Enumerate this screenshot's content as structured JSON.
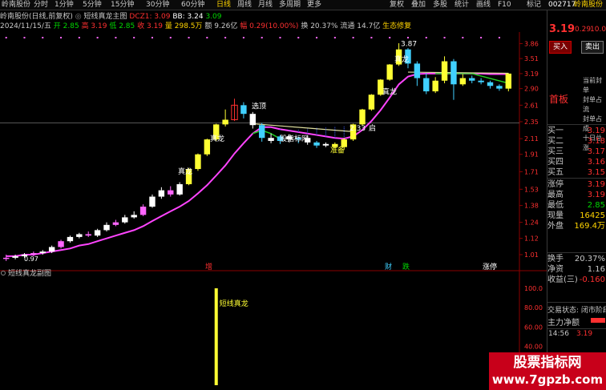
{
  "toolbar": {
    "stock_name": "岭南股份",
    "periods": [
      "分时",
      "1分钟",
      "5分钟",
      "15分钟",
      "30分钟",
      "60分钟",
      "日线",
      "周线",
      "月线",
      "多周期",
      "更多"
    ],
    "active_period": "日线",
    "tools": [
      "复权",
      "叠加",
      "多股",
      "统计",
      "画线",
      "F10",
      "标记"
    ],
    "right_code": "002717",
    "right_name": "岭南股份"
  },
  "info": {
    "line1_prefix": "岭南股份(日线,前复权)",
    "indicator_name": "短线真龙主图",
    "dcz": "DCZ1: 3.09",
    "bb": "BB: 3.24",
    "bb2": "3.09",
    "line2": {
      "date": "2024/11/15/五",
      "open": "开 2.85",
      "high": "高 3.19",
      "low": "低 2.85",
      "close": "收 3.19",
      "volume": "量 298.5万",
      "amount": "额 9.26亿",
      "change": "幅 0.29(10.00%)",
      "turnover": "换 20.37%",
      "float": "流通 14.7亿",
      "ecology": "生态修复"
    }
  },
  "chart_labels": {
    "xuanding": "选顶",
    "zhenlong": "真龙",
    "yidianchuanjiu": "股指标网",
    "zhunbei": "准备",
    "price_high": "3.87",
    "price_low": "0.97",
    "price_mid": "2.33",
    "qi_tag": "启",
    "zeng": "增",
    "cai": "财",
    "die": "跌",
    "zhangting": "涨停"
  },
  "sub_indicator": {
    "title": "短线真龙副图",
    "label": "短线真龙",
    "axis": [
      "100.0",
      "80.00",
      "60.00",
      "40.00",
      "20.00",
      "0.00"
    ]
  },
  "price_axis": [
    "3.86",
    "3.51",
    "3.19",
    "2.90",
    "2.61",
    "2.35",
    "2.11",
    "1.91",
    "1.71",
    "1.53",
    "1.38",
    "1.24",
    "1.12",
    "1.01"
  ],
  "chart_data": {
    "type": "candlestick",
    "candles": [
      {
        "o": 0.99,
        "c": 0.99,
        "h": 1.01,
        "l": 0.97
      },
      {
        "o": 0.99,
        "c": 1.0,
        "h": 1.01,
        "l": 0.98
      },
      {
        "o": 1.0,
        "c": 1.01,
        "h": 1.02,
        "l": 0.99
      },
      {
        "o": 1.01,
        "c": 1.02,
        "h": 1.03,
        "l": 1.0
      },
      {
        "o": 1.02,
        "c": 1.03,
        "h": 1.04,
        "l": 1.01
      },
      {
        "o": 1.03,
        "c": 1.06,
        "h": 1.07,
        "l": 1.02
      },
      {
        "o": 1.06,
        "c": 1.1,
        "h": 1.11,
        "l": 1.05
      },
      {
        "o": 1.1,
        "c": 1.13,
        "h": 1.14,
        "l": 1.09
      },
      {
        "o": 1.13,
        "c": 1.15,
        "h": 1.16,
        "l": 1.12
      },
      {
        "o": 1.15,
        "c": 1.14,
        "h": 1.17,
        "l": 1.13
      },
      {
        "o": 1.14,
        "c": 1.18,
        "h": 1.19,
        "l": 1.13
      },
      {
        "o": 1.18,
        "c": 1.22,
        "h": 1.24,
        "l": 1.17
      },
      {
        "o": 1.22,
        "c": 1.24,
        "h": 1.26,
        "l": 1.21
      },
      {
        "o": 1.24,
        "c": 1.28,
        "h": 1.3,
        "l": 1.23
      },
      {
        "o": 1.28,
        "c": 1.3,
        "h": 1.33,
        "l": 1.27
      },
      {
        "o": 1.3,
        "c": 1.37,
        "h": 1.39,
        "l": 1.29
      },
      {
        "o": 1.37,
        "c": 1.46,
        "h": 1.48,
        "l": 1.36
      },
      {
        "o": 1.46,
        "c": 1.52,
        "h": 1.55,
        "l": 1.44
      },
      {
        "o": 1.52,
        "c": 1.48,
        "h": 1.56,
        "l": 1.46
      },
      {
        "o": 1.48,
        "c": 1.58,
        "h": 1.6,
        "l": 1.47
      },
      {
        "o": 1.58,
        "c": 1.74,
        "h": 1.75,
        "l": 1.57
      },
      {
        "o": 1.74,
        "c": 1.91,
        "h": 1.92,
        "l": 1.72
      },
      {
        "o": 1.91,
        "c": 2.1,
        "h": 2.11,
        "l": 1.89
      },
      {
        "o": 2.1,
        "c": 2.31,
        "h": 2.32,
        "l": 2.08
      },
      {
        "o": 2.31,
        "c": 2.38,
        "h": 2.54,
        "l": 2.28
      },
      {
        "o": 2.38,
        "c": 2.61,
        "h": 2.72,
        "l": 2.36
      },
      {
        "o": 2.61,
        "c": 2.47,
        "h": 2.66,
        "l": 2.4
      },
      {
        "o": 2.47,
        "c": 2.3,
        "h": 2.5,
        "l": 2.25
      },
      {
        "o": 2.3,
        "c": 2.12,
        "h": 2.33,
        "l": 2.07
      },
      {
        "o": 2.12,
        "c": 2.08,
        "h": 2.18,
        "l": 2.05
      },
      {
        "o": 2.08,
        "c": 2.14,
        "h": 2.16,
        "l": 2.04
      },
      {
        "o": 2.14,
        "c": 2.1,
        "h": 2.17,
        "l": 2.06
      },
      {
        "o": 2.1,
        "c": 2.12,
        "h": 2.14,
        "l": 2.05
      },
      {
        "o": 2.12,
        "c": 2.06,
        "h": 2.15,
        "l": 2.03
      },
      {
        "o": 2.06,
        "c": 2.02,
        "h": 2.08,
        "l": 1.99
      },
      {
        "o": 2.02,
        "c": 2.04,
        "h": 2.06,
        "l": 2.0
      },
      {
        "o": 2.04,
        "c": 2.0,
        "h": 2.06,
        "l": 1.98
      },
      {
        "o": 2.0,
        "c": 2.1,
        "h": 2.12,
        "l": 1.97
      },
      {
        "o": 2.1,
        "c": 2.31,
        "h": 2.32,
        "l": 2.08
      },
      {
        "o": 2.31,
        "c": 2.54,
        "h": 2.55,
        "l": 2.29
      },
      {
        "o": 2.54,
        "c": 2.79,
        "h": 2.8,
        "l": 2.52
      },
      {
        "o": 2.79,
        "c": 3.07,
        "h": 3.08,
        "l": 2.77
      },
      {
        "o": 3.07,
        "c": 3.38,
        "h": 3.39,
        "l": 3.05
      },
      {
        "o": 3.38,
        "c": 3.72,
        "h": 3.87,
        "l": 3.35
      },
      {
        "o": 3.72,
        "c": 3.4,
        "h": 3.75,
        "l": 3.3
      },
      {
        "o": 3.4,
        "c": 3.1,
        "h": 3.45,
        "l": 2.95
      },
      {
        "o": 3.1,
        "c": 2.85,
        "h": 3.2,
        "l": 2.8
      },
      {
        "o": 2.85,
        "c": 3.05,
        "h": 3.12,
        "l": 2.82
      },
      {
        "o": 3.05,
        "c": 3.45,
        "h": 3.56,
        "l": 3.0
      },
      {
        "o": 3.45,
        "c": 2.98,
        "h": 3.5,
        "l": 2.7
      },
      {
        "o": 2.98,
        "c": 3.1,
        "h": 3.18,
        "l": 2.95
      },
      {
        "o": 3.1,
        "c": 3.05,
        "h": 3.15,
        "l": 3.0
      },
      {
        "o": 3.05,
        "c": 3.02,
        "h": 3.1,
        "l": 2.98
      },
      {
        "o": 3.02,
        "c": 2.95,
        "h": 3.05,
        "l": 2.9
      },
      {
        "o": 2.95,
        "c": 2.9,
        "h": 2.98,
        "l": 2.86
      },
      {
        "o": 2.9,
        "c": 3.19,
        "h": 3.2,
        "l": 2.85
      }
    ],
    "ma_line": [
      1.0,
      1.0,
      1.01,
      1.01,
      1.02,
      1.03,
      1.04,
      1.05,
      1.07,
      1.08,
      1.1,
      1.12,
      1.14,
      1.16,
      1.18,
      1.21,
      1.25,
      1.29,
      1.33,
      1.37,
      1.42,
      1.49,
      1.57,
      1.67,
      1.78,
      1.92,
      2.05,
      2.18,
      2.27,
      2.27,
      2.24,
      2.22,
      2.2,
      2.18,
      2.16,
      2.14,
      2.12,
      2.11,
      2.14,
      2.23,
      2.36,
      2.53,
      2.74,
      2.98,
      3.13,
      3.18,
      3.19,
      3.19,
      3.19,
      3.19,
      3.19,
      3.19,
      3.19,
      3.18,
      3.18,
      3.18
    ]
  },
  "right_panel": {
    "price": "3.19",
    "change": "0.29",
    "pct": "10.00%",
    "buy_btn": "买入",
    "sell_btn": "卖出",
    "tag": "首板",
    "notes": [
      "当前封单",
      "封单占流",
      "封单占成",
      "十日总涨"
    ],
    "book": [
      {
        "label": "买一",
        "val": "3.19"
      },
      {
        "label": "买二",
        "val": "3.18"
      },
      {
        "label": "买三",
        "val": "3.17"
      },
      {
        "label": "买四",
        "val": "3.16"
      },
      {
        "label": "买五",
        "val": "3.15"
      }
    ],
    "stats": [
      {
        "label": "涨停",
        "val": "3.19"
      },
      {
        "label": "最高",
        "val": "3.19"
      },
      {
        "label": "最低",
        "val": "2.85"
      },
      {
        "label": "现量",
        "val": "16425"
      },
      {
        "label": "外盘",
        "val": "169.4万"
      }
    ],
    "stats2": [
      {
        "label": "换手",
        "val": "20.37%"
      },
      {
        "label": "净资",
        "val": "1.16"
      },
      {
        "label": "收益(三)",
        "val": "-0.160"
      }
    ],
    "trade_state": "交易状态: 闭市阶段",
    "main_flow": "主力净额",
    "time": "14:56",
    "time_val": "3.19"
  },
  "watermark": {
    "line1": "股票指标网",
    "line2": "www.7gpzb.com"
  }
}
